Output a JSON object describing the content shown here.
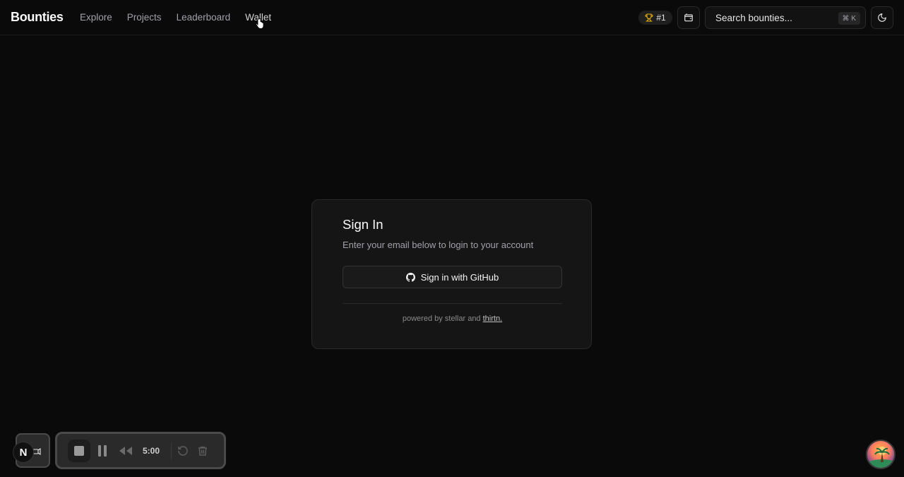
{
  "header": {
    "brand": "Bounties",
    "nav": [
      "Explore",
      "Projects",
      "Leaderboard",
      "Wallet"
    ],
    "rank": "#1",
    "search_placeholder": "Search bounties...",
    "search_shortcut": "⌘ K"
  },
  "signin": {
    "title": "Sign In",
    "description": "Enter your email below to login to your account",
    "github_button": "Sign in with GitHub",
    "powered_prefix": "powered by stellar and ",
    "powered_link": "thirtn."
  },
  "recorder": {
    "badge_letter": "N",
    "time": "5:00"
  },
  "colors": {
    "background": "#0a0a0a",
    "card": "#151515",
    "border": "#2a2a2a",
    "muted_text": "#a1a1aa"
  }
}
